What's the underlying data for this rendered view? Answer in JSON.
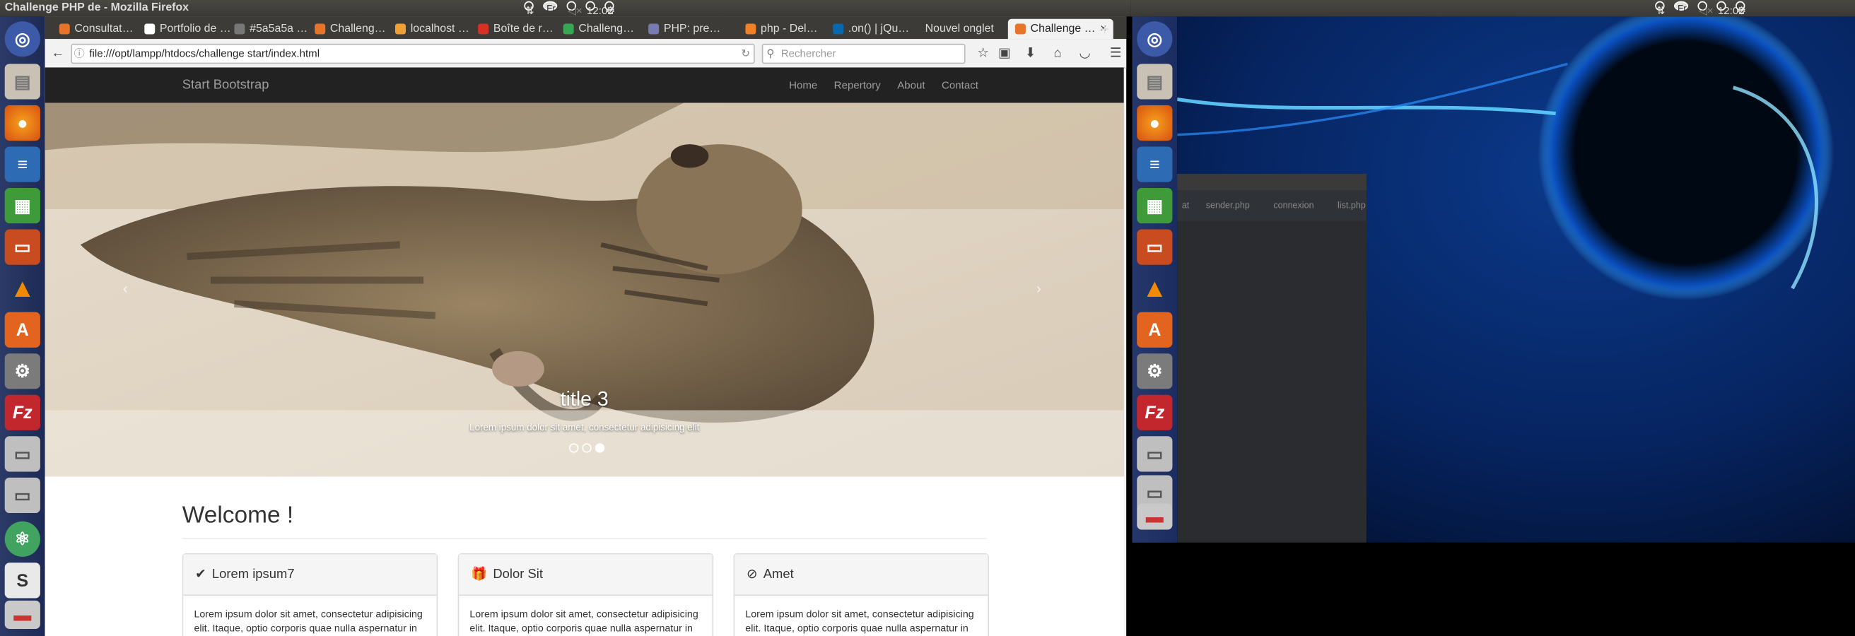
{
  "window_title": "Challenge PHP de - Mozilla Firefox",
  "panel": {
    "keyboard": "Fr",
    "time": "12:02"
  },
  "tabs": [
    {
      "label": "Consultat…",
      "color": "#e8742a"
    },
    {
      "label": "Portfolio de …",
      "color": "#ffffff"
    },
    {
      "label": "#5a5a5a …",
      "color": "#777777"
    },
    {
      "label": "Challeng…",
      "color": "#e8742a"
    },
    {
      "label": "localhost …",
      "color": "#f0a030"
    },
    {
      "label": "Boîte de r…",
      "color": "#d93025"
    },
    {
      "label": "Challeng…",
      "color": "#34a853"
    },
    {
      "label": "PHP: pre…",
      "color": "#777bb3"
    },
    {
      "label": "php - Del…",
      "color": "#f48024"
    },
    {
      "label": ".on() | jQu…",
      "color": "#0769ad"
    },
    {
      "label": "Nouvel onglet",
      "color": ""
    },
    {
      "label": "Challenge …",
      "color": "#e8742a"
    }
  ],
  "url": "file:///opt/lampp/htdocs/challenge start/index.html",
  "search_placeholder": "Rechercher",
  "site": {
    "brand": "Start Bootstrap",
    "nav": [
      "Home",
      "Repertory",
      "About",
      "Contact"
    ],
    "caption_title": "title 3",
    "caption_text": "Lorem ipsum dolor sit amet, consectetur adipisicing elit",
    "active_slide": 3,
    "welcome": "Welcome !",
    "cards": [
      {
        "title": "Lorem ipsum7",
        "icon": "check-icon",
        "text": "Lorem ipsum dolor sit amet, consectetur adipisicing elit. Itaque, optio corporis quae nulla aspernatur in"
      },
      {
        "title": "Dolor Sit",
        "icon": "gift-icon",
        "text": "Lorem ipsum dolor sit amet, consectetur adipisicing elit. Itaque, optio corporis quae nulla aspernatur in"
      },
      {
        "title": "Amet",
        "icon": "compass-icon",
        "text": "Lorem ipsum dolor sit amet, consectetur adipisicing elit. Itaque, optio corporis quae nulla aspernatur in"
      }
    ]
  },
  "editor_tabs": [
    "at",
    "sender.php",
    "connexion",
    "list.php"
  ]
}
